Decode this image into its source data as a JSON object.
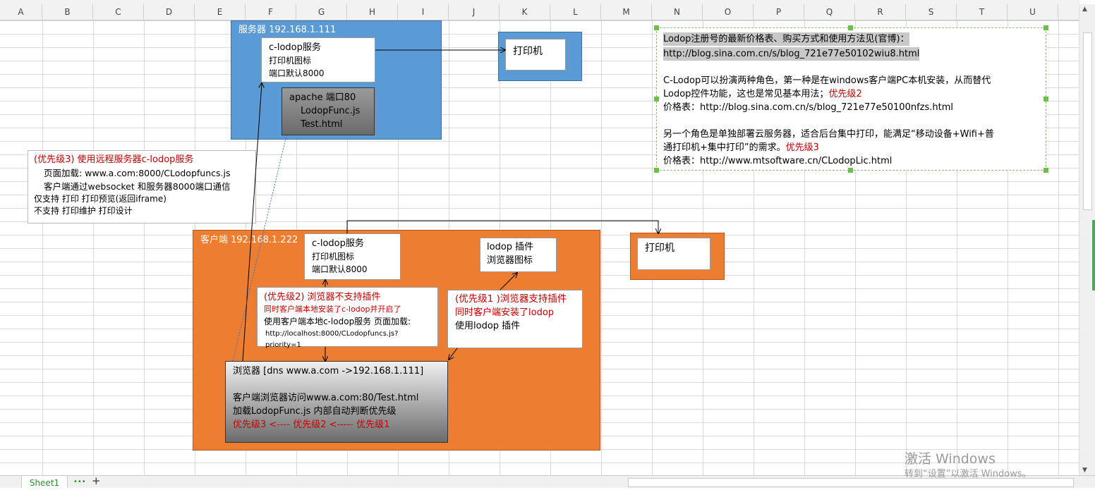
{
  "columns": [
    "A",
    "B",
    "C",
    "D",
    "E",
    "F",
    "G",
    "H",
    "I",
    "J",
    "K",
    "L",
    "M",
    "N",
    "O",
    "P",
    "Q",
    "R",
    "S",
    "T",
    "U"
  ],
  "server": {
    "title": "服务器 192.168.1.111",
    "clodop": [
      "c-lodop服务",
      "打印机图标",
      "端口默认8000"
    ],
    "apache": [
      "apache 端口80",
      "LodopFunc.js",
      "Test.html"
    ]
  },
  "printer_top": "打印机",
  "printer_right": "打印机",
  "priority3_box": {
    "title": "(优先级3)  使用远程服务器c-lodop服务",
    "line1": "页面加载: www.a.com:8000/CLodopfuncs.js",
    "line2": "客户端通过websocket 和服务器8000端口通信",
    "line3": "仅支持  打印  打印预览(返回iframe)",
    "line4": "不支持  打印维护  打印设计"
  },
  "client": {
    "title": "客户端  192.168.1.222",
    "clodop": [
      "c-lodop服务",
      "打印机图标",
      "端口默认8000"
    ],
    "plugin": [
      "lodop 插件",
      "浏览器图标"
    ],
    "priority2": {
      "title": "(优先级2) 浏览器不支持插件",
      "line1": "同时客户端本地安装了c-lodop并开启了",
      "line2": "使用客户端本地c-lodop服务 页面加载:",
      "line3": "http://localhost:8000/CLodopfuncs.js?priority=1"
    },
    "priority1": {
      "title": "(优先级1 )浏览器支持插件",
      "line1": "同时客户端安装了lodop",
      "line2": "使用lodop 插件"
    },
    "browser": {
      "title": "浏览器  [dns www.a.com ->192.168.1.111]",
      "line1": "客户端浏览器访问www.a.com:80/Test.html",
      "line2": "加载LodopFunc.js 内部自动判断优先级",
      "line3": "优先级3  <---- 优先级2  <----- 优先级1"
    }
  },
  "info": {
    "line1": "Lodop注册号的最新价格表、购买方式和使用方法见(官博)：",
    "line2": "http://blog.sina.com.cn/s/blog_721e77e50102wiu8.html",
    "line3": "C-Lodop可以扮演两种角色，第一种是在windows客户端PC本机安装，从而替代",
    "line4a": "Lodop控件功能，这也是常见基本用法；",
    "line4b": "优先级2",
    "line5": "价格表：http://blog.sina.com.cn/s/blog_721e77e50100nfzs.html",
    "line6": "另一个角色是单独部署云服务器，适合后台集中打印，能满足“移动设备+Wifi+普",
    "line7a": "通打印机+集中打印”的需求。",
    "line7b": "优先级3",
    "line8": "价格表：http://www.mtsoftware.cn/CLodopLic.html"
  },
  "sheet_tab": "Sheet1",
  "add_sheet": "+",
  "more_sheets": "•••",
  "watermark": {
    "line1": "激活 Windows",
    "line2": "转到“设置”以激活 Windows。"
  },
  "colors": {
    "server_blue": "#5b9bd5",
    "client_orange": "#ed7d31",
    "red_text": "#c00000",
    "gray_gradient_dark": "#6b6b6b"
  }
}
